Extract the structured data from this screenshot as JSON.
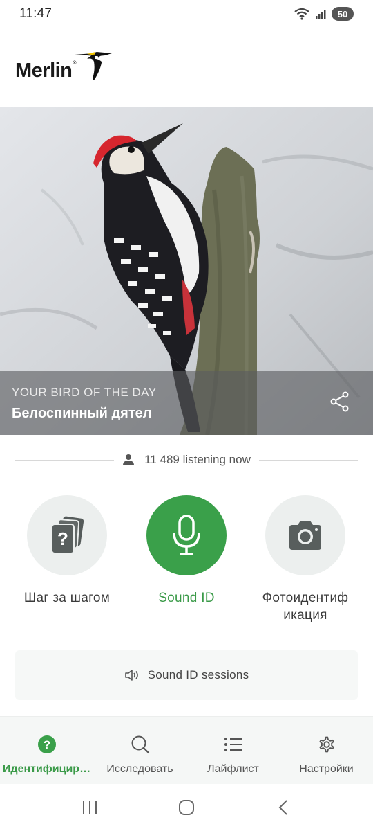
{
  "status_bar": {
    "time": "11:47",
    "battery": "50"
  },
  "header": {
    "logo_text": "Merlin",
    "logo_mark": "®"
  },
  "hero": {
    "kicker": "YOUR BIRD OF THE DAY",
    "bird_name": "Белоспинный дятел"
  },
  "listening": {
    "text": "11 489 listening now"
  },
  "actions": [
    {
      "label": "Шаг за шагом",
      "icon": "step-by-step-cards-icon"
    },
    {
      "label": "Sound ID",
      "icon": "microphone-icon"
    },
    {
      "label_line1": "Фотоидентиф",
      "label_line2": "икация",
      "icon": "camera-icon"
    }
  ],
  "sessions": {
    "label": "Sound ID sessions",
    "icon": "speaker-icon"
  },
  "bottom_nav": [
    {
      "label": "Идентифицир…",
      "icon": "question-circle-icon",
      "active": true
    },
    {
      "label": "Исследовать",
      "icon": "search-icon",
      "active": false
    },
    {
      "label": "Лайфлист",
      "icon": "list-icon",
      "active": false
    },
    {
      "label": "Настройки",
      "icon": "gear-icon",
      "active": false
    }
  ],
  "colors": {
    "accent_green": "#3aa04a",
    "circle_gray": "#ecefee",
    "nav_bg": "#f5f7f6"
  }
}
